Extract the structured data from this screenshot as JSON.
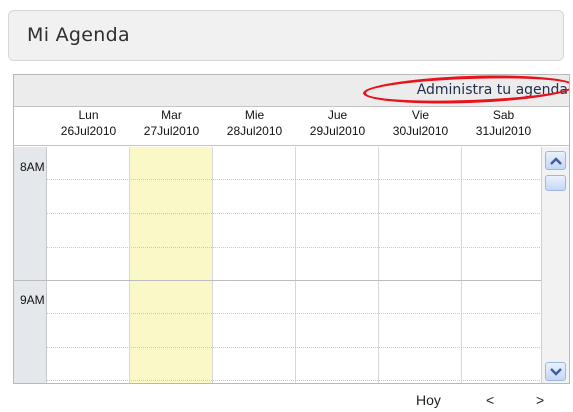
{
  "header": {
    "title": "Mi Agenda"
  },
  "toolbar": {
    "admin_link": "Administra tu agenda"
  },
  "days": [
    {
      "name": "Lun",
      "date": "26Jul2010"
    },
    {
      "name": "Mar",
      "date": "27Jul2010"
    },
    {
      "name": "Mie",
      "date": "28Jul2010"
    },
    {
      "name": "Jue",
      "date": "29Jul2010"
    },
    {
      "name": "Vie",
      "date": "30Jul2010"
    },
    {
      "name": "Sab",
      "date": "31Jul2010"
    }
  ],
  "hours": [
    "8AM",
    "9AM"
  ],
  "today_index": 1,
  "nav": {
    "today": "Hoy",
    "prev": "<",
    "next": ">"
  },
  "colors": {
    "today_bg": "#fbf8c8",
    "highlight_ring": "#e8121b"
  }
}
